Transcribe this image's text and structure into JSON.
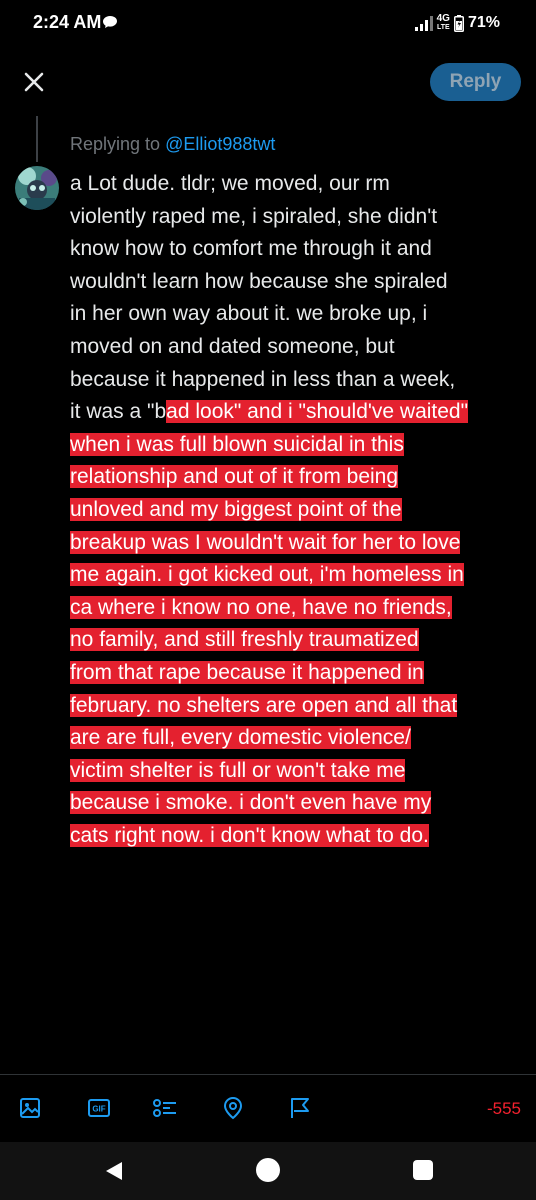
{
  "status_bar": {
    "time": "2:24 AM",
    "network_top": "4G",
    "network_bottom": "LTE",
    "battery": "71%"
  },
  "header": {
    "close_icon": "close-icon",
    "reply_label": "Reply",
    "reply_color": "#1a5f92"
  },
  "replying": {
    "prefix": "Replying to ",
    "handle": "@Elliot988twt",
    "handle_color": "#1d9bf0"
  },
  "post": {
    "lines": [
      "a Lot dude. tldr; we moved, our rm",
      "violently raped me, i spiraled, she didn't",
      "know how to comfort me through it and",
      "wouldn't learn how because she spiraled",
      "in her own way about it. we broke up, i",
      "moved on and dated someone, but",
      "because it happened in less than a week,"
    ],
    "mixed_line_plain": "it was a \"b",
    "mixed_line_highlight": "ad look\" and i \"should've waited\"",
    "highlighted_lines": [
      "when i was full blown suicidal in this",
      "relationship and out of it from being",
      "unloved and my biggest point of the",
      "breakup was I wouldn't wait for her to love",
      "me again. i got kicked out, i'm homeless in",
      "ca where i know no one, have no friends,",
      "no family, and still freshly traumatized",
      "from that rape because it happened in",
      "february. no shelters are open and all that",
      "are are full, every domestic violence/",
      "victim shelter is full or won't take me",
      "because i smoke. i don't even have my",
      "cats right now. i don't know what to do."
    ],
    "highlight_color": "#e4212f"
  },
  "toolbar": {
    "icons": [
      "image-icon",
      "gif-icon",
      "poll-icon",
      "location-icon",
      "flag-icon"
    ],
    "gif_label": "GIF",
    "char_count": "-555",
    "accent": "#1d9bf0"
  },
  "nav": {
    "icons": [
      "back-icon",
      "home-icon",
      "recents-icon"
    ]
  }
}
